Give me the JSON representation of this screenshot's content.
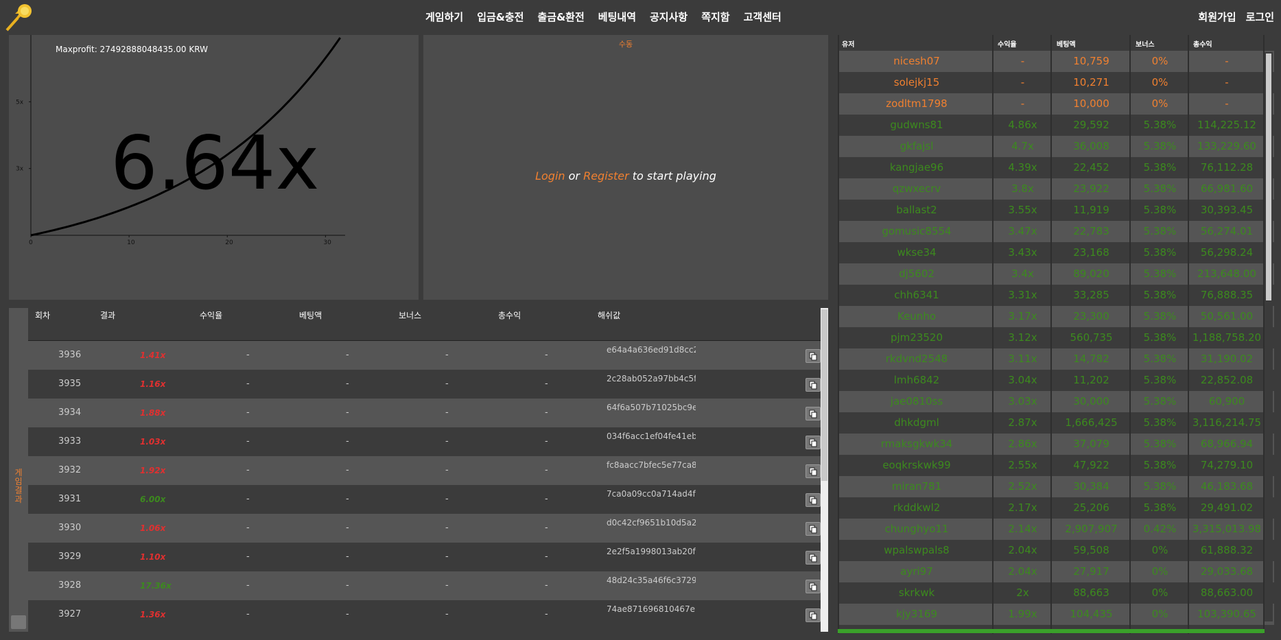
{
  "header": {
    "nav": [
      "게임하기",
      "입금&충전",
      "출금&환전",
      "베팅내역",
      "공지사항",
      "쪽지함",
      "고객센터"
    ],
    "auth": [
      "회원가입",
      "로그인"
    ],
    "logo_icon": "fireball-icon"
  },
  "chart": {
    "maxprofit_text": "Maxprofit: 27492888048435.00 KRW",
    "multiplier_text": "6.64x",
    "chart_data": {
      "type": "line",
      "x_ticks": [
        "0",
        "10",
        "20",
        "30"
      ],
      "y_ticks": [
        "3x",
        "5x"
      ],
      "xlim": [
        0,
        32
      ],
      "ylim": [
        1,
        7
      ],
      "curve_growth_rate": 0.0614,
      "current_x": 31.5,
      "current_value": 6.64,
      "line_color": "#000000"
    }
  },
  "control": {
    "tab_label": "수동",
    "login_link": "Login",
    "or_text": " or ",
    "register_link": "Register",
    "tail_text": " to start playing"
  },
  "history": {
    "tab_label": "게임결과",
    "columns": [
      "회차",
      "결과",
      "수익율",
      "베팅액",
      "보너스",
      "총수익",
      "해쉬값"
    ],
    "rows": [
      {
        "round": "3936",
        "result": "1.41x",
        "color": "#e03030",
        "rate": "-",
        "bet": "-",
        "bonus": "-",
        "total": "-",
        "hash": "e64a4a636ed91d8cc2"
      },
      {
        "round": "3935",
        "result": "1.16x",
        "color": "#e03030",
        "rate": "-",
        "bet": "-",
        "bonus": "-",
        "total": "-",
        "hash": "2c28ab052a97bb4c5f"
      },
      {
        "round": "3934",
        "result": "1.88x",
        "color": "#e03030",
        "rate": "-",
        "bet": "-",
        "bonus": "-",
        "total": "-",
        "hash": "64f6a507b71025bc9e"
      },
      {
        "round": "3933",
        "result": "1.03x",
        "color": "#e03030",
        "rate": "-",
        "bet": "-",
        "bonus": "-",
        "total": "-",
        "hash": "034f6acc1ef04fe41eb"
      },
      {
        "round": "3932",
        "result": "1.92x",
        "color": "#e03030",
        "rate": "-",
        "bet": "-",
        "bonus": "-",
        "total": "-",
        "hash": "fc8aacc7bfec5e77ca8"
      },
      {
        "round": "3931",
        "result": "6.00x",
        "color": "#3c8a1e",
        "rate": "-",
        "bet": "-",
        "bonus": "-",
        "total": "-",
        "hash": "7ca0a09cc0a714ad4f"
      },
      {
        "round": "3930",
        "result": "1.06x",
        "color": "#e03030",
        "rate": "-",
        "bet": "-",
        "bonus": "-",
        "total": "-",
        "hash": "d0c42cf9651b10d5a2"
      },
      {
        "round": "3929",
        "result": "1.10x",
        "color": "#e03030",
        "rate": "-",
        "bet": "-",
        "bonus": "-",
        "total": "-",
        "hash": "2e2f5a1998013ab20f"
      },
      {
        "round": "3928",
        "result": "17.36x",
        "color": "#3c8a1e",
        "rate": "-",
        "bet": "-",
        "bonus": "-",
        "total": "-",
        "hash": "48d24c35a46f6c3729"
      },
      {
        "round": "3927",
        "result": "1.36x",
        "color": "#e03030",
        "rate": "-",
        "bet": "-",
        "bonus": "-",
        "total": "-",
        "hash": "74ae871696810467e"
      }
    ]
  },
  "users": {
    "columns": [
      "유저",
      "수익율",
      "베팅액",
      "보너스",
      "총수익"
    ],
    "rows": [
      {
        "user": "nicesh07",
        "rate": "-",
        "bet": "10,759",
        "bonus": "0%",
        "total": "-",
        "status": "orange"
      },
      {
        "user": "solejkj15",
        "rate": "-",
        "bet": "10,271",
        "bonus": "0%",
        "total": "-",
        "status": "orange"
      },
      {
        "user": "zodltm1798",
        "rate": "-",
        "bet": "10,000",
        "bonus": "0%",
        "total": "-",
        "status": "orange"
      },
      {
        "user": "gudwns81",
        "rate": "4.86x",
        "bet": "29,592",
        "bonus": "5.38%",
        "total": "114,225.12",
        "status": "green"
      },
      {
        "user": "gkfajsl",
        "rate": "4.7x",
        "bet": "36,008",
        "bonus": "5.38%",
        "total": "133,229.60",
        "status": "green"
      },
      {
        "user": "kangjae96",
        "rate": "4.39x",
        "bet": "22,452",
        "bonus": "5.38%",
        "total": "76,112.28",
        "status": "green"
      },
      {
        "user": "qzwxecrv",
        "rate": "3.8x",
        "bet": "23,922",
        "bonus": "5.38%",
        "total": "66,981.60",
        "status": "green"
      },
      {
        "user": "ballast2",
        "rate": "3.55x",
        "bet": "11,919",
        "bonus": "5.38%",
        "total": "30,393.45",
        "status": "green"
      },
      {
        "user": "gomusic8554",
        "rate": "3.47x",
        "bet": "22,783",
        "bonus": "5.38%",
        "total": "56,274.01",
        "status": "green"
      },
      {
        "user": "wkse34",
        "rate": "3.43x",
        "bet": "23,168",
        "bonus": "5.38%",
        "total": "56,298.24",
        "status": "green"
      },
      {
        "user": "dj5602",
        "rate": "3.4x",
        "bet": "89,020",
        "bonus": "5.38%",
        "total": "213,648.00",
        "status": "green"
      },
      {
        "user": "chh6341",
        "rate": "3.31x",
        "bet": "33,285",
        "bonus": "5.38%",
        "total": "76,888.35",
        "status": "green"
      },
      {
        "user": "Keunho",
        "rate": "3.17x",
        "bet": "23,300",
        "bonus": "5.38%",
        "total": "50,561.00",
        "status": "green"
      },
      {
        "user": "pjm23520",
        "rate": "3.12x",
        "bet": "560,735",
        "bonus": "5.38%",
        "total": "1,188,758.20",
        "status": "green"
      },
      {
        "user": "rkdvnd2548",
        "rate": "3.11x",
        "bet": "14,782",
        "bonus": "5.38%",
        "total": "31,190.02",
        "status": "green"
      },
      {
        "user": "lmh6842",
        "rate": "3.04x",
        "bet": "11,202",
        "bonus": "5.38%",
        "total": "22,852.08",
        "status": "green"
      },
      {
        "user": "jae0810ss",
        "rate": "3.03x",
        "bet": "30,000",
        "bonus": "5.38%",
        "total": "60,900",
        "status": "green"
      },
      {
        "user": "dhkdgml",
        "rate": "2.87x",
        "bet": "1,666,425",
        "bonus": "5.38%",
        "total": "3,116,214.75",
        "status": "green"
      },
      {
        "user": "rmaksgkwk34",
        "rate": "2.86x",
        "bet": "37,079",
        "bonus": "5.38%",
        "total": "68,966.94",
        "status": "green"
      },
      {
        "user": "eoqkrskwk99",
        "rate": "2.55x",
        "bet": "47,922",
        "bonus": "5.38%",
        "total": "74,279.10",
        "status": "green"
      },
      {
        "user": "miran781",
        "rate": "2.52x",
        "bet": "30,384",
        "bonus": "5.38%",
        "total": "46,183.68",
        "status": "green"
      },
      {
        "user": "rkddkwl2",
        "rate": "2.17x",
        "bet": "25,206",
        "bonus": "5.38%",
        "total": "29,491.02",
        "status": "green"
      },
      {
        "user": "chunghyo11",
        "rate": "2.14x",
        "bet": "2,907,907",
        "bonus": "0.42%",
        "total": "3,315,013.98",
        "status": "green"
      },
      {
        "user": "wpalswpals8",
        "rate": "2.04x",
        "bet": "59,508",
        "bonus": "0%",
        "total": "61,888.32",
        "status": "green"
      },
      {
        "user": "ayri97",
        "rate": "2.04x",
        "bet": "27,917",
        "bonus": "0%",
        "total": "29,033.68",
        "status": "green"
      },
      {
        "user": "skrkwk",
        "rate": "2x",
        "bet": "88,663",
        "bonus": "0%",
        "total": "88,663.00",
        "status": "green"
      },
      {
        "user": "kjy3169",
        "rate": "1.99x",
        "bet": "104,435",
        "bonus": "0%",
        "total": "103,390.65",
        "status": "green"
      }
    ]
  }
}
